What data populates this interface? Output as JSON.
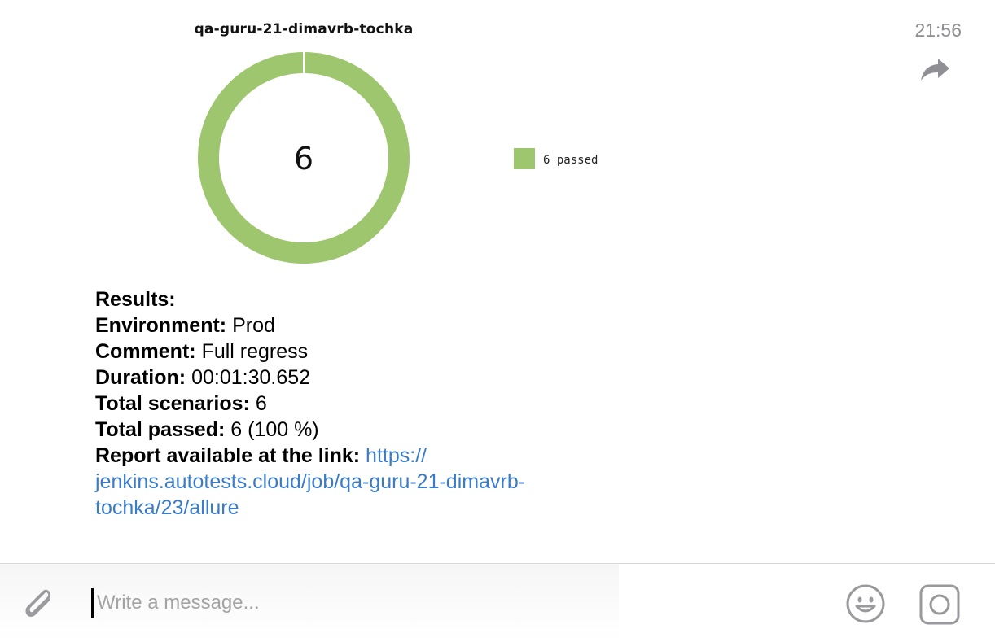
{
  "message": {
    "time": "21:56",
    "chart": {
      "title": "qa-guru-21-dimavrb-tochka",
      "center_value": "6",
      "legend_label": "6 passed",
      "colors": {
        "passed": "#9ec66f"
      }
    },
    "results": {
      "heading": "Results:",
      "environment_label": "Environment:",
      "environment_value": "Prod",
      "comment_label": "Comment:",
      "comment_value": "Full regress",
      "duration_label": "Duration:",
      "duration_value": "00:01:30.652",
      "total_scenarios_label": "Total scenarios:",
      "total_scenarios_value": "6",
      "total_passed_label": "Total passed:",
      "total_passed_value": "6 (100 %)",
      "report_label": "Report available at the link:",
      "report_link_part1": "https://",
      "report_link_part2": "jenkins.autotests.cloud/job/qa-guru-21-dimavrb-",
      "report_link_part3": "tochka/23/allure"
    }
  },
  "composer": {
    "placeholder": "Write a message...",
    "value": ""
  },
  "chart_data": {
    "type": "pie",
    "title": "qa-guru-21-dimavrb-tochka",
    "categories": [
      "passed"
    ],
    "values": [
      6
    ],
    "legend": [
      "6 passed"
    ],
    "center_label": "6",
    "legend_position": "right"
  }
}
